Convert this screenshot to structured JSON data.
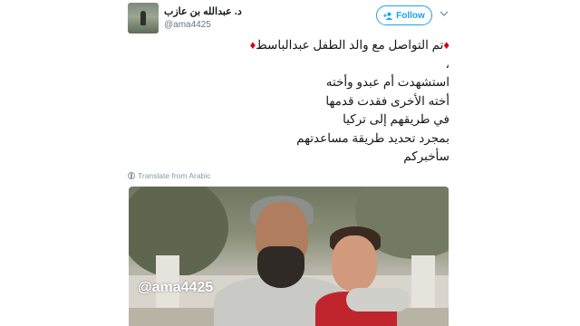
{
  "tweet": {
    "author": {
      "display_name": "د. عبدالله بن عازب",
      "handle": "@ama4425"
    },
    "follow_label": "Follow",
    "text_lines": [
      "تم التواصل مع والد الطفل عبدالباسط",
      "،",
      "استشهدت أم عبدو وأخته",
      "أخته الأخرى فقدت قدمها",
      "في طريقهم إلى تركيا",
      "بمجرد تحديد طريقة مساعدتهم",
      "سأخبركم"
    ],
    "translate_label": "Translate from Arabic",
    "media": {
      "watermark": "@ama4425"
    },
    "icons": {
      "follow": "add-user-icon",
      "caret": "chevron-down-icon",
      "translate": "globe-icon",
      "bullet": "red-diamond-icon"
    },
    "colors": {
      "accent": "#1da1f2",
      "diamond": "#d0021b",
      "muted": "#657786"
    }
  }
}
